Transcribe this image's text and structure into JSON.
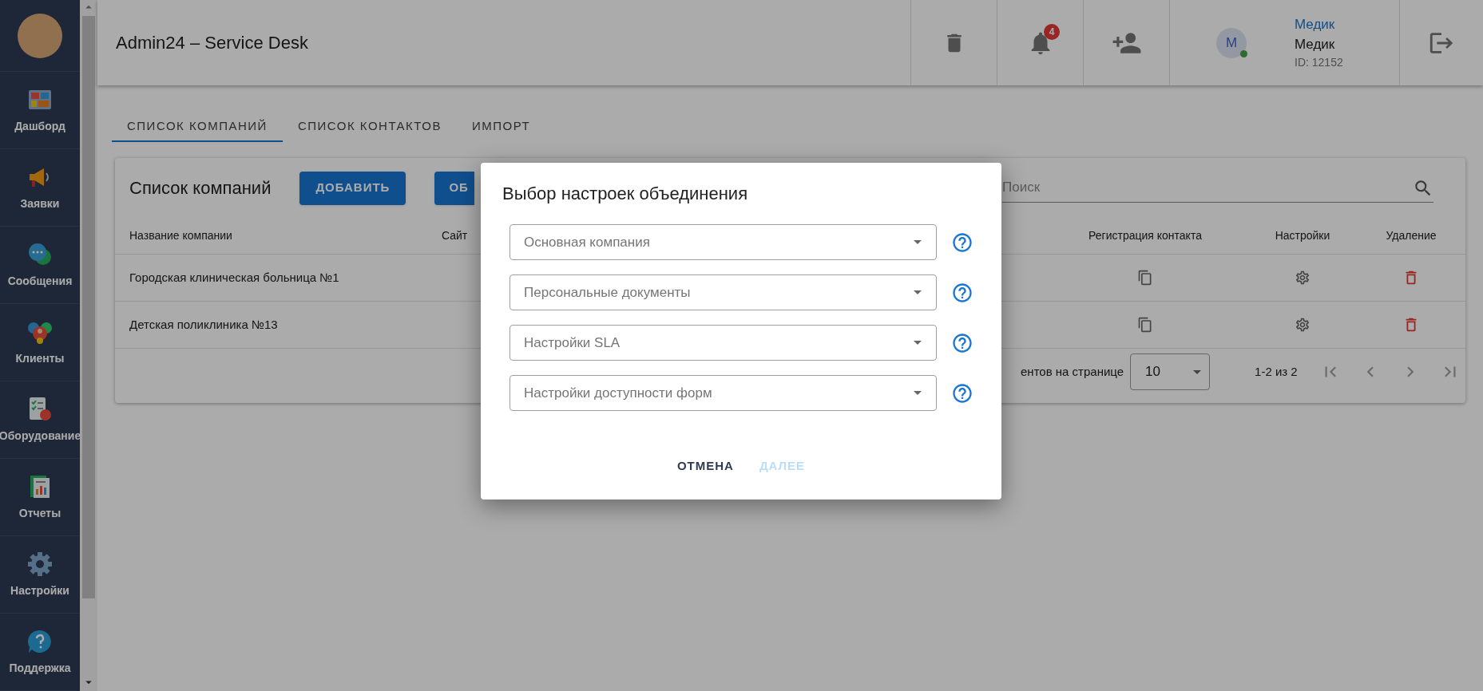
{
  "sidebar": {
    "items": [
      {
        "label": "Дашборд",
        "kind": "dashboard"
      },
      {
        "label": "Заявки",
        "kind": "megaphone"
      },
      {
        "label": "Сообщения",
        "kind": "chat"
      },
      {
        "label": "Клиенты",
        "kind": "clients"
      },
      {
        "label": "Оборудование",
        "kind": "equipment"
      },
      {
        "label": "Отчеты",
        "kind": "reports"
      },
      {
        "label": "Настройки",
        "kind": "gear"
      },
      {
        "label": "Поддержка",
        "kind": "help"
      }
    ]
  },
  "header": {
    "title": "Admin24 – Service Desk",
    "notifications": "4",
    "user": {
      "avatar": "M",
      "online": true,
      "link": "Медик",
      "name": "Медик",
      "id": "ID: 12152"
    }
  },
  "tabs": [
    {
      "label": "СПИСОК КОМПАНИЙ",
      "selected": true
    },
    {
      "label": "СПИСОК КОНТАКТОВ",
      "selected": false
    },
    {
      "label": "ИМПОРТ",
      "selected": false
    }
  ],
  "card": {
    "title": "Список компаний",
    "buttons": [
      "ДОБАВИТЬ",
      "ОБ"
    ],
    "search": {
      "placeholder": "Поиск"
    },
    "columns": [
      "Название компании",
      "Сайт",
      "Регистрация контакта",
      "Настройки",
      "Удаление"
    ],
    "rows": [
      {
        "company": "Городская клиническая больница №1"
      },
      {
        "company": "Детская поликлиника №13"
      }
    ],
    "pagination": {
      "label": "ентов на странице",
      "per_page": "10",
      "range": "1-2 из 2"
    }
  },
  "dialog": {
    "title": "Выбор настроек объединения",
    "fields": [
      {
        "placeholder": "Основная компания"
      },
      {
        "placeholder": "Персональные документы"
      },
      {
        "placeholder": "Настройки SLA"
      },
      {
        "placeholder": "Настройки доступности форм"
      }
    ],
    "buttons": [
      {
        "label": "ОТМЕНА",
        "disabled": false
      },
      {
        "label": "ДАЛЕЕ",
        "disabled": true
      }
    ]
  }
}
